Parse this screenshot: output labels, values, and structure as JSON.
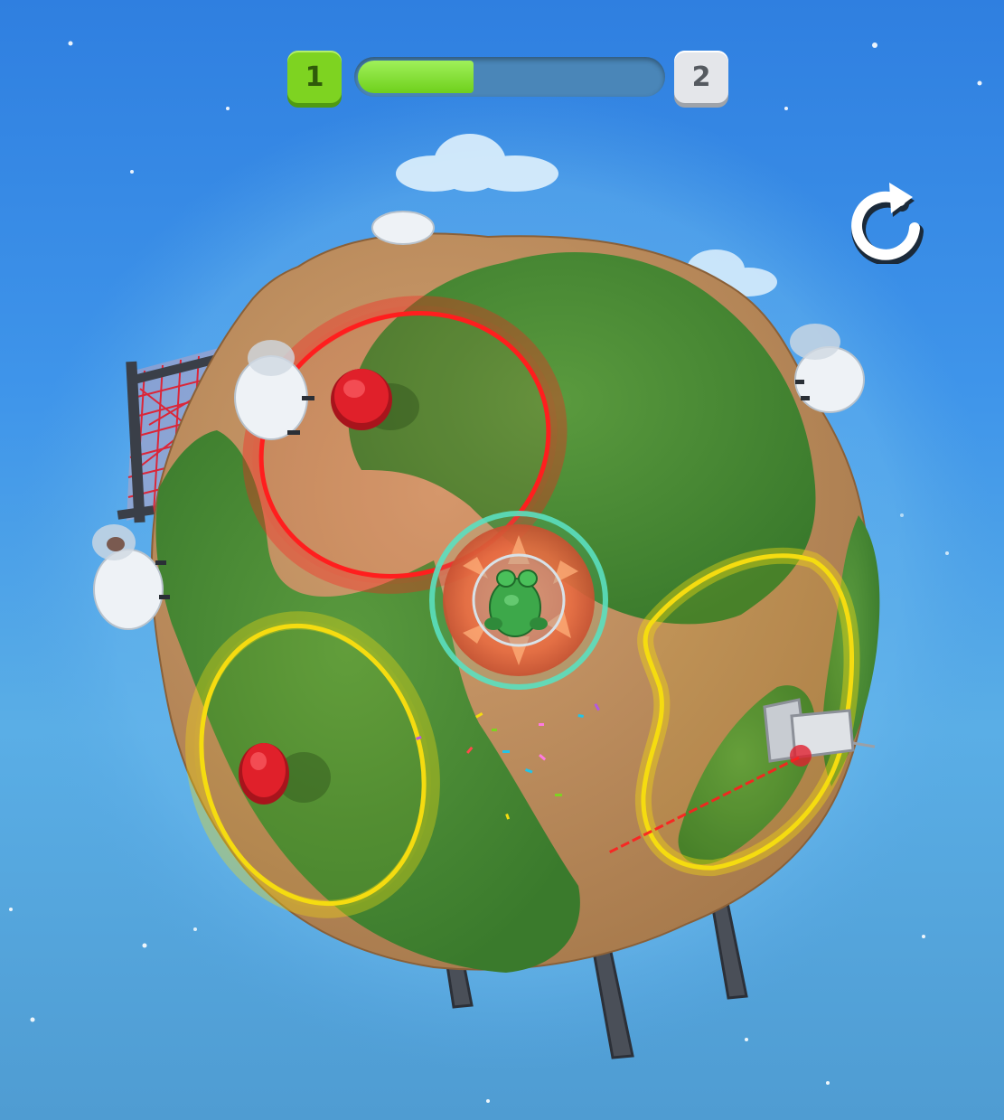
{
  "hud": {
    "current_level": "1",
    "next_level": "2",
    "level_progress": 0.38
  },
  "controls": {
    "restart_icon": "restart-icon"
  },
  "colors": {
    "sky_top": "#2f7fe0",
    "grass": "#4a8a34",
    "dirt": "#b98a5a",
    "danger_ring": "#ff1e1e",
    "target_ring": "#f5dc10",
    "progress_fill": "#7ed321",
    "shield": "#5be0c0"
  },
  "scene": {
    "player": "green-frog-in-shield-bubble",
    "sheep_count": 4,
    "red_buttons": 2,
    "danger_zones": 1,
    "target_zones": 2,
    "hazards": [
      "red-net-trap",
      "laser-turret"
    ]
  }
}
